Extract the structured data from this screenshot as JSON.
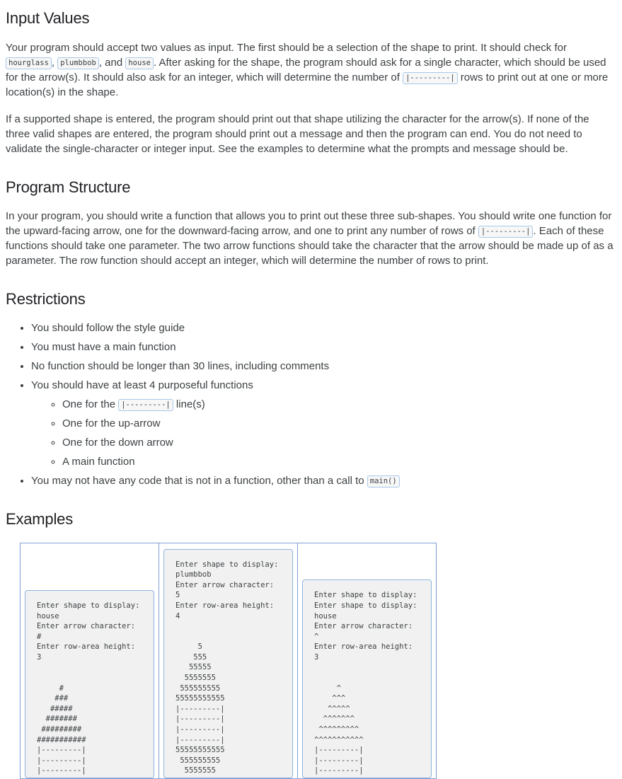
{
  "sections": {
    "input_values": {
      "heading": "Input Values",
      "p1_a": "Your program should accept two values as input. The first should be a selection of the shape to print. It should check for ",
      "code_hourglass": "hourglass",
      "p1_b": ", ",
      "code_plumbbob": "plumbbob",
      "p1_c": ", and ",
      "code_house": "house",
      "p1_d": ". After asking for the shape, the program should ask for a single character, which should be used for the arrow(s). It should also ask for an integer, which will determine the number of ",
      "code_rowline": "|---------|",
      "p1_e": " rows to print out at one or more location(s) in the shape.",
      "p2": "If a supported shape is entered, the program should print out that shape utilizing the character for the arrow(s). If none of the three valid shapes are entered, the program should print out a message and then the program can end. You do not need to validate the single-character or integer input. See the examples to determine what the prompts and message should be."
    },
    "program_structure": {
      "heading": "Program Structure",
      "p1_a": "In your program, you should write a function that allows you to print out these three sub-shapes. You should write one function for the upward-facing arrow, one for the downward-facing arrow, and one to print any number of rows of ",
      "code_rowline": "|---------|",
      "p1_b": ". Each of these functions should take one parameter. The two arrow functions should take the character that the arrow should be made up of as a parameter. The row function should accept an integer, which will determine the number of rows to print."
    },
    "restrictions": {
      "heading": "Restrictions",
      "items": [
        {
          "text": "You should follow the style guide"
        },
        {
          "text": "You must have a main function"
        },
        {
          "text": "No function should be longer than 30 lines, including comments"
        },
        {
          "text": "You should have at least 4 purposeful functions",
          "subitems": [
            {
              "prefix": "One for the ",
              "code": "|---------|",
              "suffix": " line(s)"
            },
            {
              "prefix": "One for the up-arrow",
              "code": "",
              "suffix": ""
            },
            {
              "prefix": "One for the down arrow",
              "code": "",
              "suffix": ""
            },
            {
              "prefix": "A main function",
              "code": "",
              "suffix": ""
            }
          ]
        },
        {
          "text_a": "You may not have any code that is not in a function, other than a call to ",
          "code": "main()",
          "text_b": ""
        }
      ]
    },
    "examples": {
      "heading": "Examples",
      "cells": [
        {
          "name": "example-house-hash",
          "code": "Enter shape to display:\nhouse\nEnter arrow character:\n#\nEnter row-area height:\n3\n\n\n     #\n    ###\n   #####\n  #######\n #########\n###########\n|---------|\n|---------|\n|---------|"
        },
        {
          "name": "example-plumbbob-five",
          "code": "Enter shape to display:\nplumbbob\nEnter arrow character:\n5\nEnter row-area height:\n4\n\n\n     5\n    555\n   55555\n  5555555\n 555555555\n55555555555\n|---------|\n|---------|\n|---------|\n|---------|\n55555555555\n 555555555\n  5555555"
        },
        {
          "name": "example-house-caret",
          "code": "Enter shape to display:\nEnter shape to display:\nhouse\nEnter arrow character:\n^\nEnter row-area height:\n3\n\n\n     ^\n    ^^^\n   ^^^^^\n  ^^^^^^^\n ^^^^^^^^^\n^^^^^^^^^^^\n|---------|\n|---------|\n|---------|"
        }
      ]
    }
  },
  "colors": {
    "text": "#3c4043",
    "heading": "#202124",
    "code_border": "#8fb3dd",
    "code_bg": "#f1f1f1",
    "table_border": "#7f9fd4"
  }
}
